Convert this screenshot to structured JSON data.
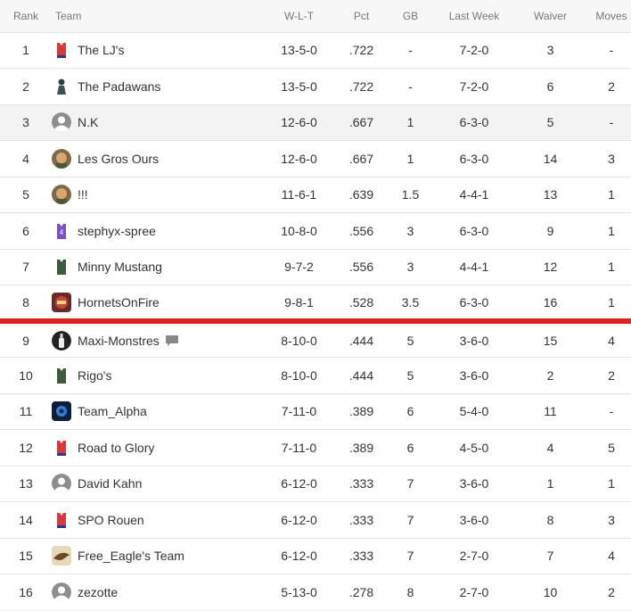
{
  "columns": {
    "rank": "Rank",
    "team": "Team",
    "wlt": "W-L-T",
    "pct": "Pct",
    "gb": "GB",
    "last_week": "Last Week",
    "waiver": "Waiver",
    "moves": "Moves"
  },
  "rows": [
    {
      "rank": "1",
      "team": "The LJ's",
      "wlt": "13-5-0",
      "pct": ".722",
      "gb": "-",
      "last_week": "7-2-0",
      "waiver": "3",
      "moves": "-",
      "icon": "red-jersey-icon"
    },
    {
      "rank": "2",
      "team": "The Padawans",
      "wlt": "13-5-0",
      "pct": ".722",
      "gb": "-",
      "last_week": "7-2-0",
      "waiver": "6",
      "moves": "2",
      "icon": "dark-figure-icon"
    },
    {
      "rank": "3",
      "team": "N.K",
      "wlt": "12-6-0",
      "pct": ".667",
      "gb": "1",
      "last_week": "6-3-0",
      "waiver": "5",
      "moves": "-",
      "icon": "default-user-icon"
    },
    {
      "rank": "4",
      "team": "Les Gros Ours",
      "wlt": "12-6-0",
      "pct": ".667",
      "gb": "1",
      "last_week": "6-3-0",
      "waiver": "14",
      "moves": "3",
      "icon": "photo-avatar-icon"
    },
    {
      "rank": "5",
      "team": "!!!",
      "wlt": "11-6-1",
      "pct": ".639",
      "gb": "1.5",
      "last_week": "4-4-1",
      "waiver": "13",
      "moves": "1",
      "icon": "photo-avatar-icon"
    },
    {
      "rank": "6",
      "team": "stephyx-spree",
      "wlt": "10-8-0",
      "pct": ".556",
      "gb": "3",
      "last_week": "6-3-0",
      "waiver": "9",
      "moves": "1",
      "icon": "purple-jersey-icon",
      "jersey_number": "4"
    },
    {
      "rank": "7",
      "team": "Minny Mustang",
      "wlt": "9-7-2",
      "pct": ".556",
      "gb": "3",
      "last_week": "4-4-1",
      "waiver": "12",
      "moves": "1",
      "icon": "green-jersey-icon"
    },
    {
      "rank": "8",
      "team": "HornetsOnFire",
      "wlt": "9-8-1",
      "pct": ".528",
      "gb": "3.5",
      "last_week": "6-3-0",
      "waiver": "16",
      "moves": "1",
      "icon": "hornets-logo-icon"
    },
    {
      "rank": "9",
      "team": "Maxi-Monstres",
      "wlt": "8-10-0",
      "pct": ".444",
      "gb": "5",
      "last_week": "3-6-0",
      "waiver": "15",
      "moves": "4",
      "icon": "bottle-icon"
    },
    {
      "rank": "10",
      "team": "Rigo's",
      "wlt": "8-10-0",
      "pct": ".444",
      "gb": "5",
      "last_week": "3-6-0",
      "waiver": "2",
      "moves": "2",
      "icon": "green-jersey-icon"
    },
    {
      "rank": "11",
      "team": "Team_Alpha",
      "wlt": "7-11-0",
      "pct": ".389",
      "gb": "6",
      "last_week": "5-4-0",
      "waiver": "11",
      "moves": "-",
      "icon": "blue-logo-icon"
    },
    {
      "rank": "12",
      "team": "Road to Glory",
      "wlt": "7-11-0",
      "pct": ".389",
      "gb": "6",
      "last_week": "4-5-0",
      "waiver": "4",
      "moves": "5",
      "icon": "red-jersey-icon"
    },
    {
      "rank": "13",
      "team": "David Kahn",
      "wlt": "6-12-0",
      "pct": ".333",
      "gb": "7",
      "last_week": "3-6-0",
      "waiver": "1",
      "moves": "1",
      "icon": "default-user-icon"
    },
    {
      "rank": "14",
      "team": "SPO Rouen",
      "wlt": "6-12-0",
      "pct": ".333",
      "gb": "7",
      "last_week": "3-6-0",
      "waiver": "8",
      "moves": "3",
      "icon": "red-jersey-icon"
    },
    {
      "rank": "15",
      "team": "Free_Eagle's Team",
      "wlt": "6-12-0",
      "pct": ".333",
      "gb": "7",
      "last_week": "2-7-0",
      "waiver": "7",
      "moves": "4",
      "icon": "eagle-icon"
    },
    {
      "rank": "16",
      "team": "zezotte",
      "wlt": "5-13-0",
      "pct": ".278",
      "gb": "8",
      "last_week": "2-7-0",
      "waiver": "10",
      "moves": "2",
      "icon": "default-user-icon"
    }
  ],
  "highlight_rank": "3",
  "playoff_line_after_rank": "8",
  "message_icon_rank": "9",
  "colors": {
    "playoff_line": "#dd2222",
    "highlight_row": "#f3f3f3",
    "header_bg": "#f7f7f7"
  }
}
